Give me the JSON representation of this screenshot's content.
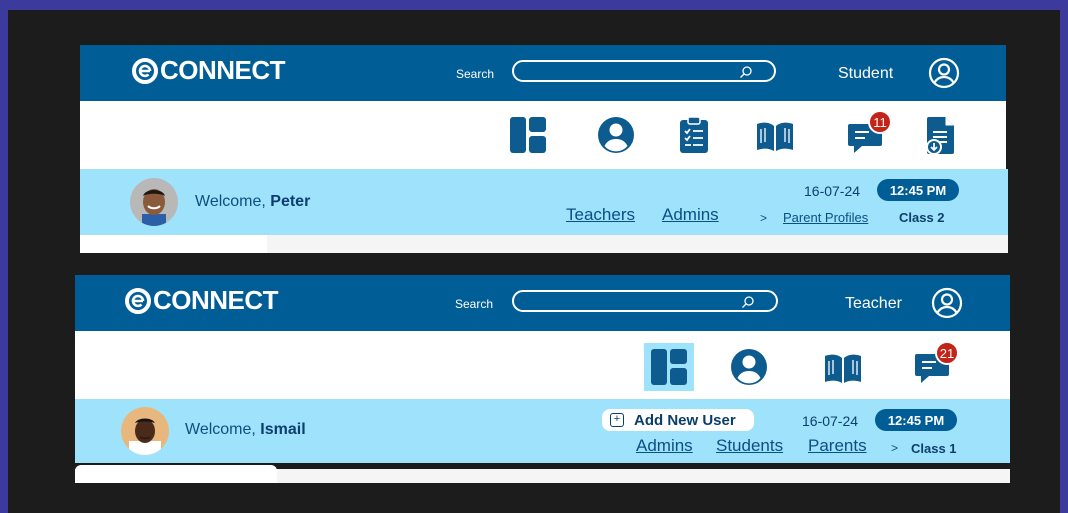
{
  "colors": {
    "brand": "#005d96",
    "nav_bg": "#ffffff",
    "welcome_bg": "#9fe2fb",
    "badge": "#c42318",
    "outer": "#3d3a9e",
    "stage": "#1c1c1c"
  },
  "student_view": {
    "logo": "CONNECT",
    "search": {
      "label": "Search",
      "value": ""
    },
    "role": "Student",
    "nav_icons": [
      "dashboard-icon",
      "profile-icon",
      "assignments-icon",
      "library-icon",
      "messages-icon",
      "report-download-icon"
    ],
    "messages_badge": "11",
    "welcome_prefix": "Welcome, ",
    "user_name": "Peter",
    "date": "16-07-24",
    "time": "12:45 PM",
    "links": [
      "Teachers",
      "Admins"
    ],
    "breadcrumb_sep": ">",
    "breadcrumb_link": "Parent Profiles",
    "class_label": "Class 2"
  },
  "teacher_view": {
    "logo": "CONNECT",
    "search": {
      "label": "Search",
      "value": ""
    },
    "role": "Teacher",
    "nav_icons": [
      "dashboard-icon",
      "profile-icon",
      "library-icon",
      "messages-icon"
    ],
    "messages_badge": "21",
    "welcome_prefix": "Welcome, ",
    "user_name": "Ismail",
    "add_user": "Add New User",
    "date": "16-07-24",
    "time": "12:45 PM",
    "links": [
      "Admins",
      "Students",
      "Parents"
    ],
    "breadcrumb_sep": ">",
    "class_label": "Class 1"
  }
}
